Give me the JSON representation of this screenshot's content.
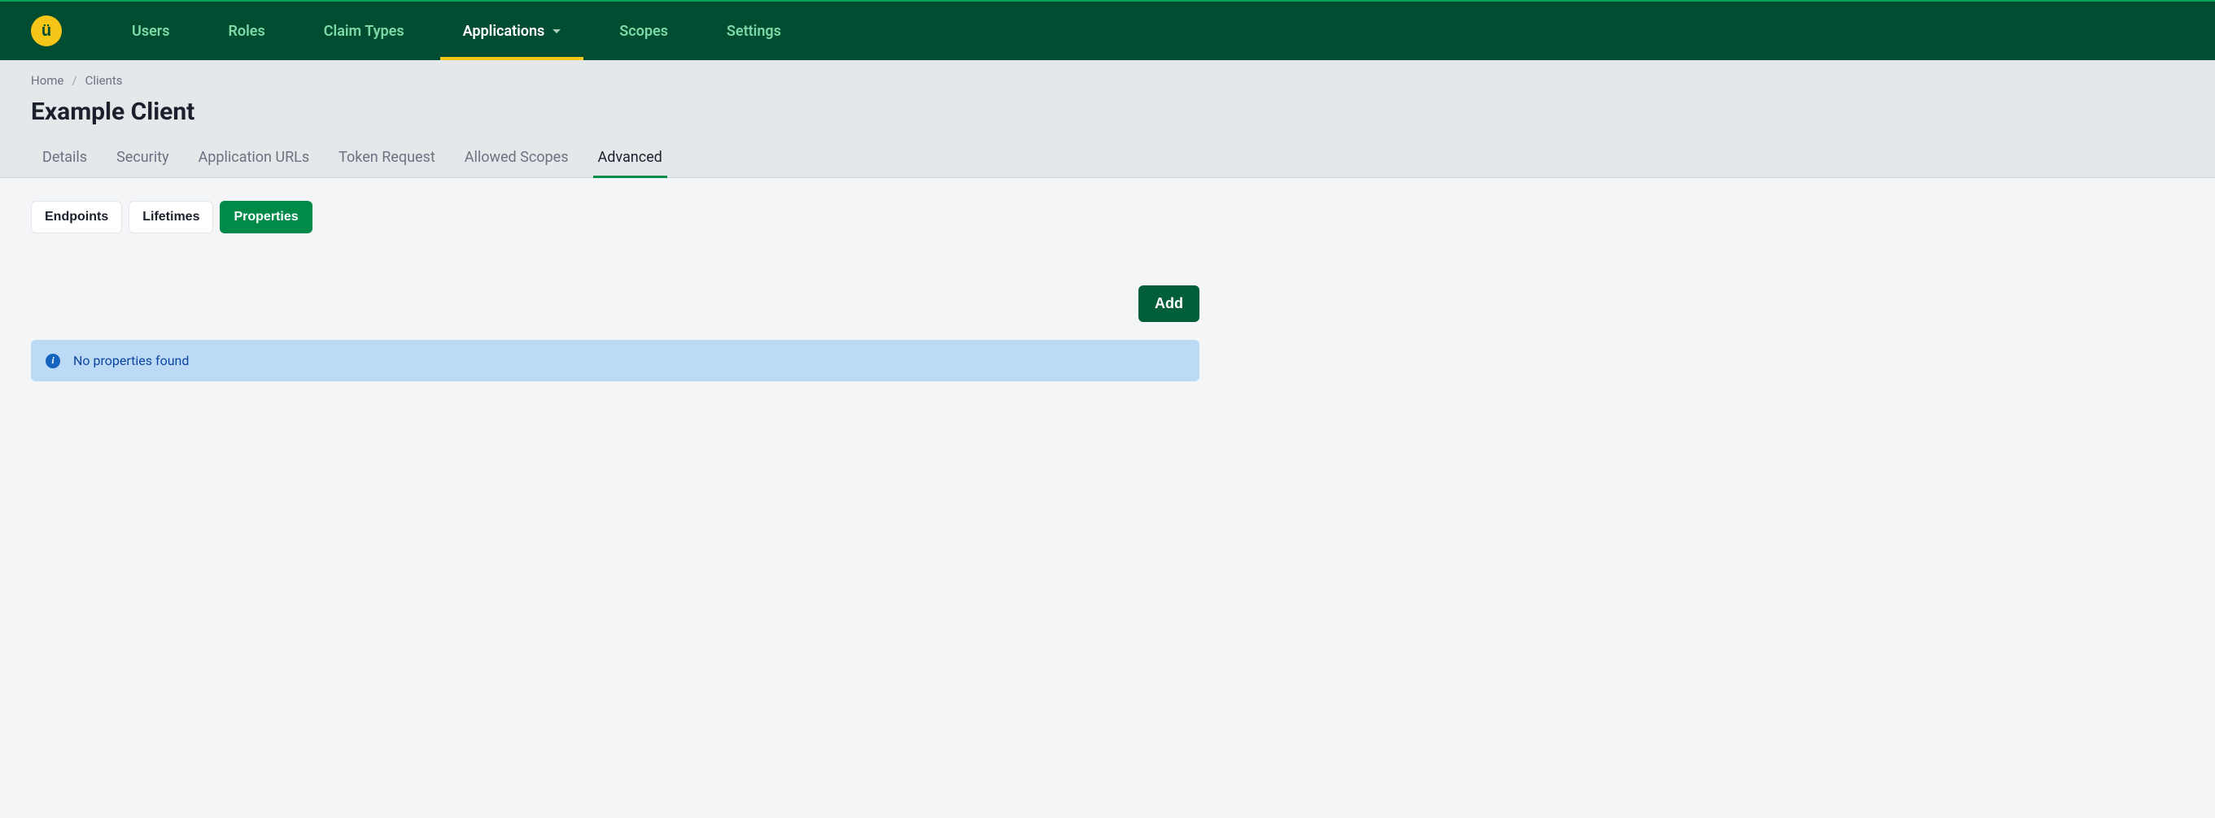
{
  "nav": {
    "items": [
      {
        "label": "Users",
        "active": false,
        "hasDropdown": false
      },
      {
        "label": "Roles",
        "active": false,
        "hasDropdown": false
      },
      {
        "label": "Claim Types",
        "active": false,
        "hasDropdown": false
      },
      {
        "label": "Applications",
        "active": true,
        "hasDropdown": true
      },
      {
        "label": "Scopes",
        "active": false,
        "hasDropdown": false
      },
      {
        "label": "Settings",
        "active": false,
        "hasDropdown": false
      }
    ]
  },
  "breadcrumb": {
    "items": [
      {
        "label": "Home"
      },
      {
        "label": "Clients"
      }
    ]
  },
  "page": {
    "title": "Example Client"
  },
  "tabs": {
    "items": [
      {
        "label": "Details",
        "active": false
      },
      {
        "label": "Security",
        "active": false
      },
      {
        "label": "Application URLs",
        "active": false
      },
      {
        "label": "Token Request",
        "active": false
      },
      {
        "label": "Allowed Scopes",
        "active": false
      },
      {
        "label": "Advanced",
        "active": true
      }
    ]
  },
  "subtabs": {
    "items": [
      {
        "label": "Endpoints",
        "active": false
      },
      {
        "label": "Lifetimes",
        "active": false
      },
      {
        "label": "Properties",
        "active": true
      }
    ]
  },
  "actions": {
    "add_label": "Add"
  },
  "alert": {
    "message": "No properties found"
  }
}
